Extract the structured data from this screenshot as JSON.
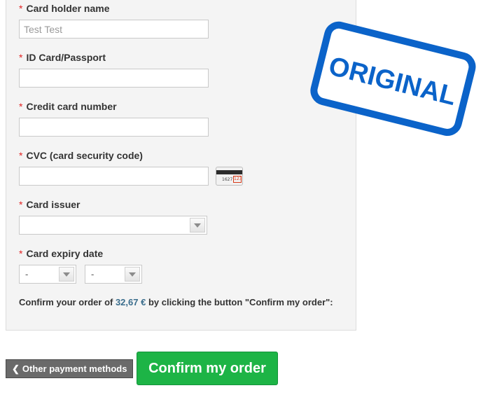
{
  "form": {
    "required_marker": "*",
    "card_holder": {
      "label": "Card holder name",
      "placeholder": "Test Test"
    },
    "id_card": {
      "label": "ID Card/Passport",
      "value": ""
    },
    "card_number": {
      "label": "Credit card number",
      "value": ""
    },
    "cvc": {
      "label": "CVC (card security code)",
      "value": "",
      "icon": "card-back-cvc-icon",
      "icon_digits": "1627",
      "icon_code": "123"
    },
    "card_issuer": {
      "label": "Card issuer",
      "selected": ""
    },
    "expiry": {
      "label": "Card expiry date",
      "month_selected": "-",
      "year_selected": "-"
    },
    "confirm_text": {
      "prefix": "Confirm your order of ",
      "amount": "32,67 €",
      "suffix": " by clicking the button \"Confirm my order\":"
    }
  },
  "actions": {
    "back_label": "Other payment methods",
    "back_icon": "chevron-left-icon",
    "confirm_label": "Confirm my order"
  },
  "stamp": {
    "text": "ORIGINAL",
    "color": "#0b63c9"
  },
  "colors": {
    "required": "#e22222",
    "amount": "#3a6d8c",
    "confirm_button": "#1db446",
    "back_button": "#6a6a6a"
  }
}
